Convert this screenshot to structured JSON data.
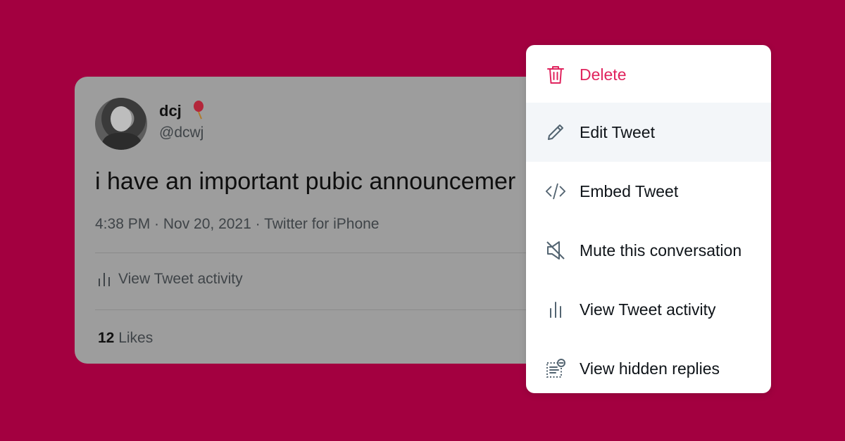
{
  "tweet": {
    "display_name": "dcj",
    "handle": "@dcwj",
    "text": "i have an important pubic announcemer",
    "meta": "4:38 PM · Nov 20, 2021 · Twitter for iPhone",
    "activity_label": "View Tweet activity",
    "likes_count": "12",
    "likes_label": "Likes"
  },
  "menu": {
    "items": [
      {
        "label": "Delete",
        "icon": "trash-icon",
        "color": "#e0245e"
      },
      {
        "label": "Edit Tweet",
        "icon": "pencil-icon"
      },
      {
        "label": "Embed Tweet",
        "icon": "code-icon"
      },
      {
        "label": "Mute this conversation",
        "icon": "mute-icon"
      },
      {
        "label": "View Tweet activity",
        "icon": "bar-chart-icon"
      },
      {
        "label": "View hidden replies",
        "icon": "hidden-replies-icon"
      }
    ]
  },
  "colors": {
    "background": "#a30040",
    "danger": "#e0245e",
    "hover": "#f3f6f9"
  }
}
